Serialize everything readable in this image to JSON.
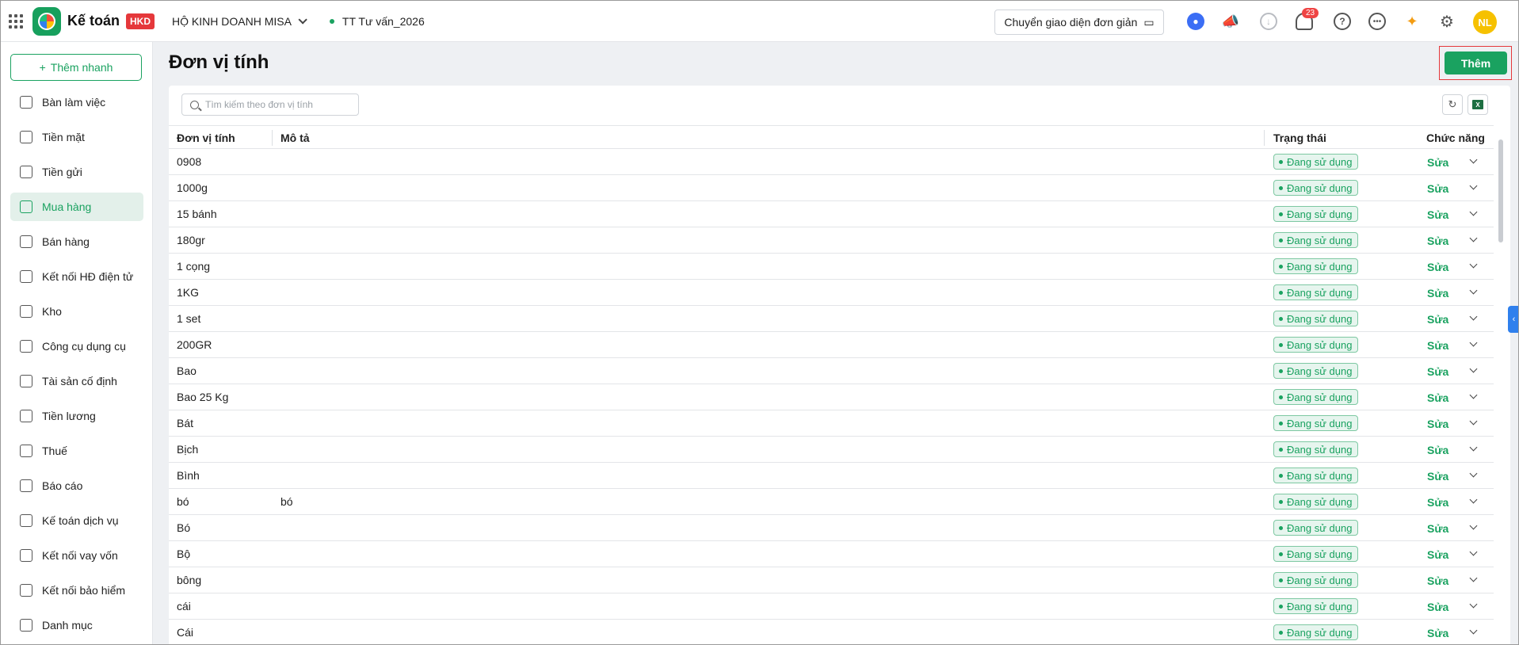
{
  "header": {
    "app_name": "Kế toán",
    "app_badge": "HKD",
    "company": "HỘ KINH DOANH MISA",
    "workspace": "TT Tư vấn_2026",
    "switch_ui_label": "Chuyển giao diện đơn giản",
    "notification_count": "23",
    "avatar_initials": "NL"
  },
  "sidebar": {
    "quick_add_label": "Thêm nhanh",
    "items": [
      {
        "label": "Bàn làm việc",
        "icon": "dashboard-icon"
      },
      {
        "label": "Tiền mặt",
        "icon": "wallet-icon"
      },
      {
        "label": "Tiền gửi",
        "icon": "card-icon"
      },
      {
        "label": "Mua hàng",
        "icon": "cart-icon"
      },
      {
        "label": "Bán hàng",
        "icon": "tag-icon"
      },
      {
        "label": "Kết nối HĐ điện tử",
        "icon": "invoice-icon"
      },
      {
        "label": "Kho",
        "icon": "box-icon"
      },
      {
        "label": "Công cụ dụng cụ",
        "icon": "tools-icon"
      },
      {
        "label": "Tài sản cố định",
        "icon": "truck-icon"
      },
      {
        "label": "Tiền lương",
        "icon": "money-icon"
      },
      {
        "label": "Thuế",
        "icon": "tax-icon"
      },
      {
        "label": "Báo cáo",
        "icon": "chart-icon"
      },
      {
        "label": "Kế toán dịch vụ",
        "icon": "briefcase-icon"
      },
      {
        "label": "Kết nối vay vốn",
        "icon": "loan-icon"
      },
      {
        "label": "Kết nối bảo hiểm",
        "icon": "shield-icon"
      },
      {
        "label": "Danh mục",
        "icon": "list-icon"
      }
    ],
    "active_index": 3
  },
  "page": {
    "title": "Đơn vị tính",
    "add_label": "Thêm",
    "search_placeholder": "Tìm kiếm theo đơn vị tính"
  },
  "table": {
    "columns": {
      "unit": "Đơn vị tính",
      "desc": "Mô tả",
      "status": "Trạng thái",
      "actions": "Chức năng"
    },
    "rows": [
      {
        "unit": "0908",
        "desc": "",
        "status": "Đang sử dụng",
        "action": "Sửa"
      },
      {
        "unit": "1000g",
        "desc": "",
        "status": "Đang sử dụng",
        "action": "Sửa"
      },
      {
        "unit": "15 bánh",
        "desc": "",
        "status": "Đang sử dụng",
        "action": "Sửa"
      },
      {
        "unit": "180gr",
        "desc": "",
        "status": "Đang sử dụng",
        "action": "Sửa"
      },
      {
        "unit": "1 cọng",
        "desc": "",
        "status": "Đang sử dụng",
        "action": "Sửa"
      },
      {
        "unit": "1KG",
        "desc": "",
        "status": "Đang sử dụng",
        "action": "Sửa"
      },
      {
        "unit": "1 set",
        "desc": "",
        "status": "Đang sử dụng",
        "action": "Sửa"
      },
      {
        "unit": "200GR",
        "desc": "",
        "status": "Đang sử dụng",
        "action": "Sửa"
      },
      {
        "unit": "Bao",
        "desc": "",
        "status": "Đang sử dụng",
        "action": "Sửa"
      },
      {
        "unit": "Bao 25 Kg",
        "desc": "",
        "status": "Đang sử dụng",
        "action": "Sửa"
      },
      {
        "unit": "Bát",
        "desc": "",
        "status": "Đang sử dụng",
        "action": "Sửa"
      },
      {
        "unit": "Bịch",
        "desc": "",
        "status": "Đang sử dụng",
        "action": "Sửa"
      },
      {
        "unit": "Bình",
        "desc": "",
        "status": "Đang sử dụng",
        "action": "Sửa"
      },
      {
        "unit": "bó",
        "desc": "bó",
        "status": "Đang sử dụng",
        "action": "Sửa"
      },
      {
        "unit": "Bó",
        "desc": "",
        "status": "Đang sử dụng",
        "action": "Sửa"
      },
      {
        "unit": "Bộ",
        "desc": "",
        "status": "Đang sử dụng",
        "action": "Sửa"
      },
      {
        "unit": "bông",
        "desc": "",
        "status": "Đang sử dụng",
        "action": "Sửa"
      },
      {
        "unit": "cái",
        "desc": "",
        "status": "Đang sử dụng",
        "action": "Sửa"
      },
      {
        "unit": "Cái",
        "desc": "",
        "status": "Đang sử dụng",
        "action": "Sửa"
      }
    ]
  },
  "colors": {
    "accent": "#1aa260",
    "badge_red": "#e5383b",
    "highlight_border": "#e5383b"
  }
}
